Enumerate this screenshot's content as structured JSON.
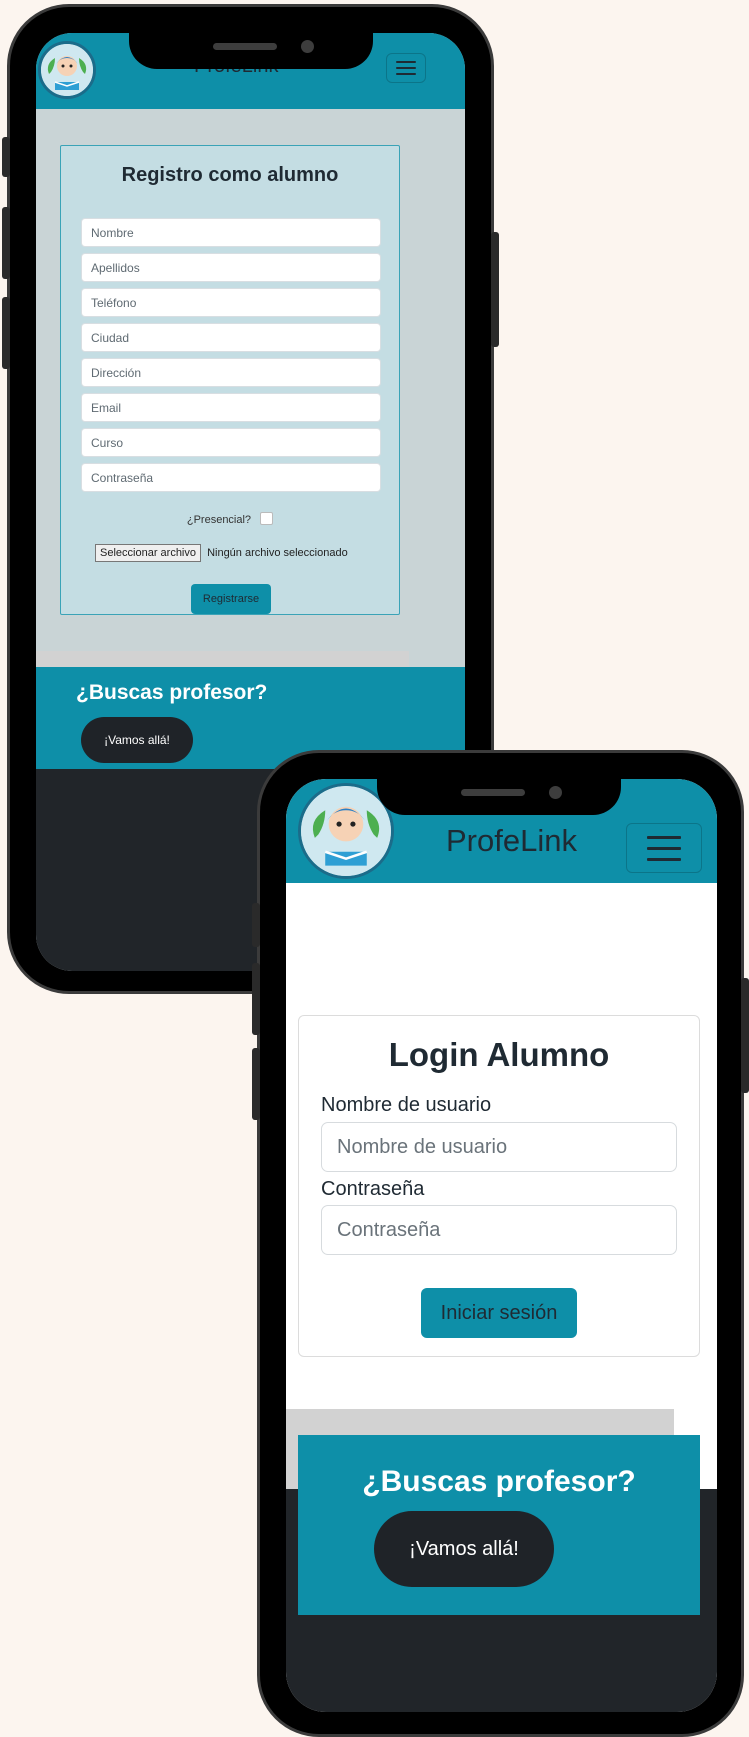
{
  "phone_register": {
    "header": {
      "brand": "ProfeLink"
    },
    "form": {
      "title": "Registro como alumno",
      "fields": [
        {
          "placeholder": "Nombre"
        },
        {
          "placeholder": "Apellidos"
        },
        {
          "placeholder": "Teléfono"
        },
        {
          "placeholder": "Ciudad"
        },
        {
          "placeholder": "Dirección"
        },
        {
          "placeholder": "Email"
        },
        {
          "placeholder": "Curso"
        },
        {
          "placeholder": "Contraseña"
        }
      ],
      "presencial_label": "¿Presencial?",
      "file_button_label": "Seleccionar archivo",
      "file_status": "Ningún archivo seleccionado",
      "submit_label": "Registrarse"
    },
    "cta": {
      "title": "¿Buscas profesor?",
      "button_label": "¡Vamos allá!"
    }
  },
  "phone_login": {
    "header": {
      "brand": "ProfeLink"
    },
    "form": {
      "title": "Login Alumno",
      "username_label": "Nombre de usuario",
      "username_placeholder": "Nombre de usuario",
      "password_label": "Contraseña",
      "password_placeholder": "Contraseña",
      "submit_label": "Iniciar sesión"
    },
    "cta": {
      "title": "¿Buscas profesor?",
      "button_label": "¡Vamos allá!"
    }
  },
  "colors": {
    "page_background": "#fcf5ef",
    "brand_teal": "#0e8fa8",
    "form_card_background": "#c4dde3",
    "footer_dark": "#212529"
  }
}
